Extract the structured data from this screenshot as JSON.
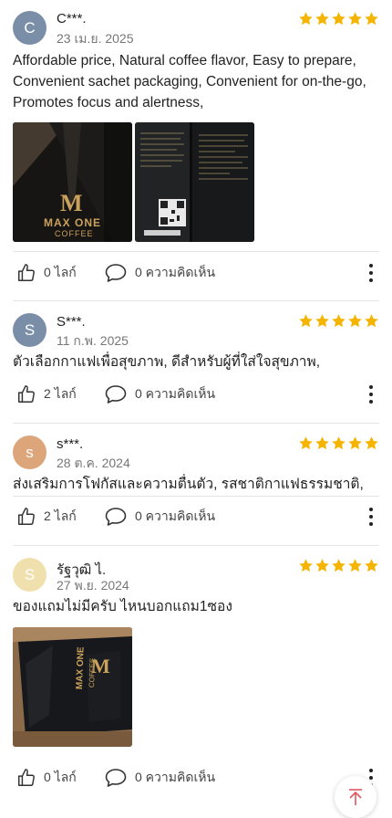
{
  "colors": {
    "star": "#f5b400",
    "avatar_1": "#7b8ea8",
    "avatar_2": "#7b8ea8",
    "avatar_3": "#dda57a",
    "avatar_4": "#f0e0ae",
    "scroll_top_accent": "#e0555e"
  },
  "icons": {
    "like": "thumbs-up-icon",
    "comment": "speech-bubble-icon",
    "more": "vertical-ellipsis-icon",
    "scroll_top": "arrow-to-top-icon",
    "rating_star": "star-icon"
  },
  "reviews": [
    {
      "avatar_letter": "C",
      "name": "C***.",
      "date": "23 เม.ย. 2025",
      "rating": 5,
      "text": "Affordable price, Natural coffee flavor, Easy to prepare, Convenient sachet packaging, Convenient for on-the-go, Promotes focus and alertness,",
      "photo_count": 2,
      "likes": "0 ไลก์",
      "comments": "0 ความคิดเห็น",
      "photo_1": {
        "logo": "M",
        "brand_line1": "MAX ONE",
        "brand_line2": "COFFEE"
      }
    },
    {
      "avatar_letter": "S",
      "name": "S***.",
      "date": "11 ก.พ. 2025",
      "rating": 5,
      "text": "ตัวเลือกกาแฟเพื่อสุขภาพ, ดีสำหรับผู้ที่ใส่ใจสุขภาพ,",
      "photo_count": 0,
      "likes": "2 ไลก์",
      "comments": "0 ความคิดเห็น"
    },
    {
      "avatar_letter": "s",
      "name": "s***.",
      "date": "28 ต.ค. 2024",
      "rating": 5,
      "text": "ส่งเสริมการโฟกัสและความตื่นตัว, รสชาติกาแฟธรรมชาติ,",
      "photo_count": 0,
      "likes": "2 ไลก์",
      "comments": "0 ความคิดเห็น"
    },
    {
      "avatar_letter": "S",
      "name": "รัฐวุฒิ ไ.",
      "date": "27 พ.ย. 2024",
      "rating": 5,
      "text": "ของแถมไม่มีครับ ไหนบอกแถม1ซอง",
      "photo_count": 1,
      "likes": "0 ไลก์",
      "comments": "0 ความคิดเห็น",
      "photo_1": {
        "logo": "M",
        "brand_line1": "MAX ONE",
        "brand_line2": "COFFEE"
      }
    }
  ]
}
